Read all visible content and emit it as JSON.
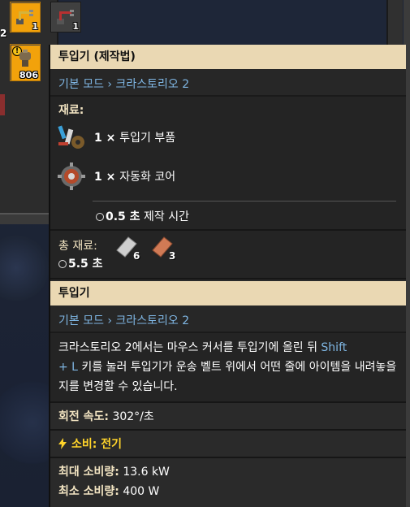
{
  "inventory": {
    "left_stack_count": "2",
    "slots": [
      {
        "name": "slot-inserter",
        "count": "1",
        "icon": "inserter-icon"
      },
      {
        "name": "slot-long-inserter",
        "count": "1",
        "icon": "long-inserter-icon"
      },
      {
        "name": "slot-burner-inserter",
        "count": "806",
        "icon": "burner-inserter-icon"
      }
    ]
  },
  "recipe_tooltip": {
    "title": "투입기 (제작법)",
    "source": "기본 모드 › 크라스토리오 2",
    "ingredients_label": "재료:",
    "ingredients": [
      {
        "amount": "1 ×",
        "name": "투입기 부품",
        "icon": "inserter-parts-icon"
      },
      {
        "amount": "1 ×",
        "name": "자동화 코어",
        "icon": "automation-core-icon"
      }
    ],
    "craft_time_value": "0.5 초",
    "craft_time_label": "제작 시간",
    "total_label": "총 재료:",
    "total_time": "5.5 초",
    "raw": [
      {
        "count": "6",
        "icon": "iron-plate-icon"
      },
      {
        "count": "3",
        "icon": "copper-plate-icon"
      }
    ]
  },
  "item_tooltip": {
    "title": "투입기",
    "source": "기본 모드 › 크라스토리오 2",
    "desc_part1": "크라스토리오 2에서는 마우스 커서를 투입기에 올린 뒤 ",
    "key1": "Shift",
    "key2": "+ L",
    "desc_part2": " 키를 눌러 투입기가 운송 벨트 위에서 어떤 줄에 아이템을 내려놓을 지를 변경할 수 있습니다.",
    "rotation_label": "회전 속도:",
    "rotation_value": "302°/초",
    "energy_label": "소비: 전기",
    "max_label": "최대 소비량:",
    "max_value": "13.6 kW",
    "min_label": "최소 소비량:",
    "min_value": "400 W"
  },
  "colors": {
    "header_bg": "#ead8b3",
    "link_blue": "#7fb6e3",
    "energy_yellow": "#ffd42a",
    "selected_slot": "#f2a20b"
  }
}
